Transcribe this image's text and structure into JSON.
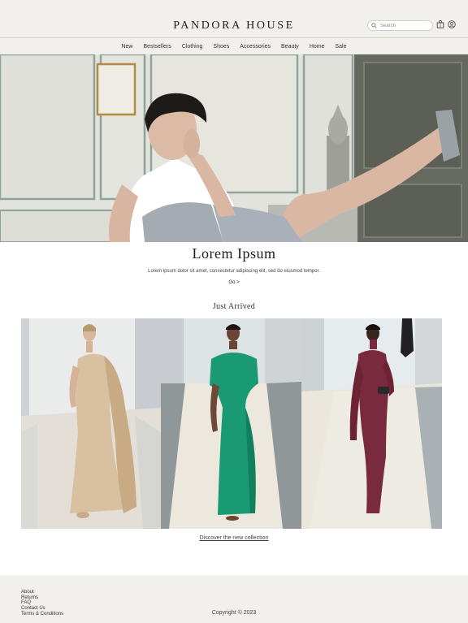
{
  "brand": {
    "name": "PANDORA HOUSE"
  },
  "search": {
    "placeholder": "Search",
    "value": ""
  },
  "header_icons": [
    "shopping-bag-icon",
    "user-icon"
  ],
  "nav": {
    "items": [
      "New",
      "Bestsellers",
      "Clothing",
      "Shoes",
      "Accessories",
      "Beauty",
      "Home",
      "Sale"
    ]
  },
  "hero": {
    "title": "Lorem Ipsum",
    "text": "Lorem ipsum dolor sit amet, consectetur adipiscing elit, sed do eiusmod tempor.",
    "link": "Go >"
  },
  "arrivals": {
    "title": "Just Arrived",
    "link": "Discover the new collection",
    "items": [
      {
        "image": "model in beige draped gown",
        "color": "#d8c0a0"
      },
      {
        "image": "model in emerald green draped dress",
        "color": "#1a9a72"
      },
      {
        "image": "model in burgundy long-sleeve dress",
        "color": "#7a2a3e"
      }
    ]
  },
  "footer": {
    "links": [
      "About",
      "Returns",
      "FAQ",
      "Contact Us",
      "Terms & Conditions"
    ],
    "copyright": "Copyright © 2023"
  },
  "colors": {
    "header_bg": "#f1f0ec",
    "page_bg": "#ffffff",
    "text": "#222222"
  }
}
